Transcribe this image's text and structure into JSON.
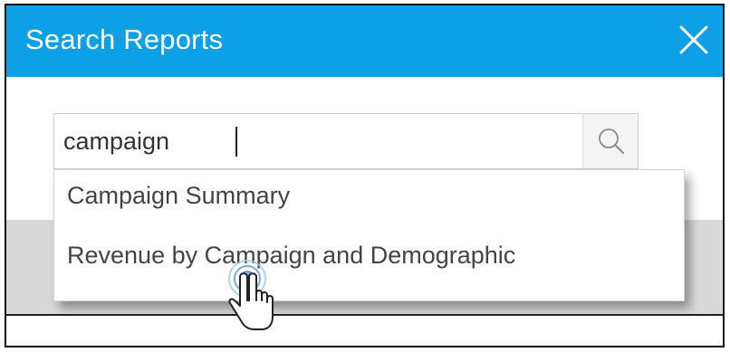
{
  "dialog": {
    "title": "Search Reports",
    "close_icon": "close-icon"
  },
  "search": {
    "value": "campaign",
    "clear_icon": "clear-icon",
    "search_icon": "magnifier-icon"
  },
  "results": [
    {
      "label": "Campaign Summary"
    },
    {
      "label": "Revenue by Campaign and Demographic"
    }
  ],
  "pointer": {
    "icon": "hand-pointer-icon"
  },
  "colors": {
    "header_bg": "#0ea0e6",
    "header_text": "#ffffff",
    "result_text": "#444444",
    "body_band": "#d9d9d9"
  }
}
